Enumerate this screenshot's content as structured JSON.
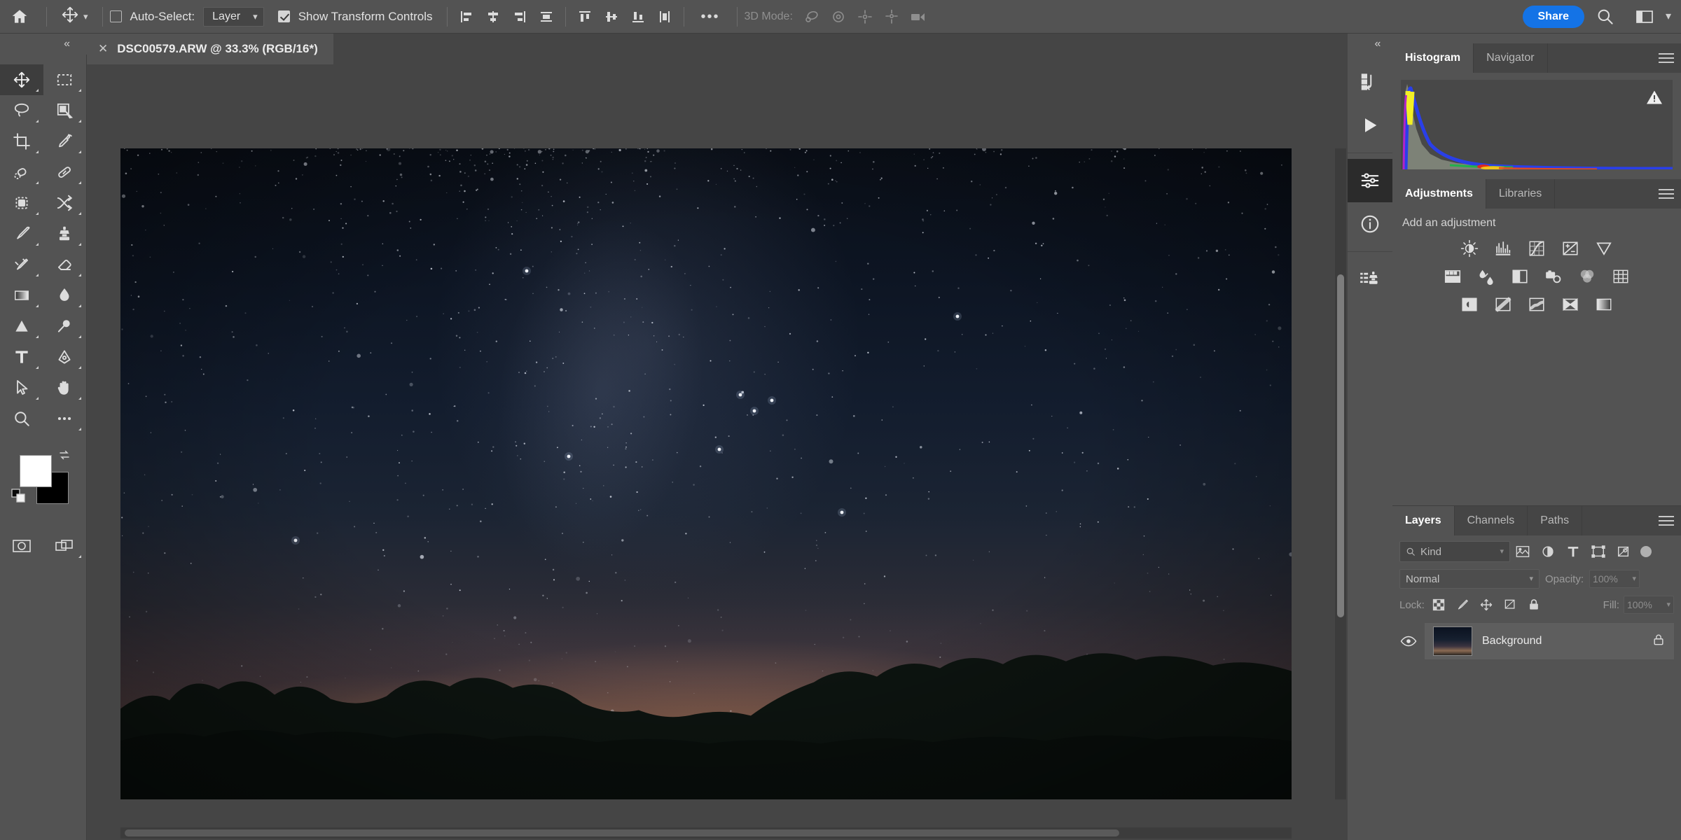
{
  "options_bar": {
    "home_icon": "home-icon",
    "tool_icon": "move-tool-icon",
    "auto_select_checked": false,
    "auto_select_label": "Auto-Select:",
    "auto_select_value": "Layer",
    "show_transform_checked": true,
    "show_transform_label": "Show Transform Controls",
    "align_icons": [
      "align-left-edges-icon",
      "align-horizontal-centers-icon",
      "align-right-edges-icon",
      "distribute-horizontally-icon",
      "align-top-edges-icon",
      "align-vertical-centers-icon",
      "align-bottom-edges-icon",
      "distribute-vertically-icon"
    ],
    "more_icon": "more-options-icon",
    "mode_3d_label": "3D Mode:",
    "mode_3d_icons": [
      "orbit-3d-icon",
      "roll-3d-icon",
      "pan-3d-icon",
      "slide-3d-icon",
      "scale-3d-camera-icon"
    ],
    "share_label": "Share",
    "search_icon": "search-icon",
    "workspace_icon": "workspace-switcher-icon",
    "workspace_chevron": "chevron-down-icon"
  },
  "tab_bar": {
    "close_icon": "close-icon",
    "document_title": "DSC00579.ARW @ 33.3% (RGB/16*)",
    "collapse_left": "«",
    "collapse_right": "«"
  },
  "toolbar": {
    "tools": [
      {
        "name": "move-tool",
        "selected": true
      },
      {
        "name": "rectangular-marquee-tool",
        "selected": false
      },
      {
        "name": "lasso-tool",
        "selected": false
      },
      {
        "name": "object-selection-tool",
        "selected": false
      },
      {
        "name": "crop-tool",
        "selected": false
      },
      {
        "name": "eyedropper-tool",
        "selected": false
      },
      {
        "name": "spot-healing-brush-tool",
        "selected": false
      },
      {
        "name": "patch-tool",
        "selected": false
      },
      {
        "name": "remove-tool",
        "selected": false
      },
      {
        "name": "content-aware-move-tool",
        "selected": false
      },
      {
        "name": "brush-tool",
        "selected": false
      },
      {
        "name": "clone-stamp-tool",
        "selected": false
      },
      {
        "name": "history-brush-tool",
        "selected": false
      },
      {
        "name": "eraser-tool",
        "selected": false
      },
      {
        "name": "gradient-tool",
        "selected": false
      },
      {
        "name": "blur-tool",
        "selected": false
      },
      {
        "name": "dodge-tool",
        "selected": false
      },
      {
        "name": "pen-tool",
        "selected": false
      },
      {
        "name": "type-tool",
        "selected": false
      },
      {
        "name": "shape-tool",
        "selected": false
      },
      {
        "name": "path-selection-tool",
        "selected": false
      },
      {
        "name": "hand-tool",
        "selected": false
      },
      {
        "name": "zoom-tool",
        "selected": false
      },
      {
        "name": "edit-toolbar-tool",
        "selected": false
      }
    ],
    "foreground_color": "#ffffff",
    "background_color": "#000000",
    "swap_icon": "swap-colors-icon",
    "default_icon": "default-colors-icon",
    "quick_mask_icon": "quick-mask-icon",
    "screen_mode_icon": "screen-mode-icon"
  },
  "canvas": {
    "zoom_level": "33.3%",
    "image_alt": "night-sky-milky-way-over-treeline",
    "scrollbar_vertical": "vertical-scrollbar",
    "scrollbar_horizontal": "horizontal-scrollbar"
  },
  "icon_rail": {
    "items": [
      {
        "name": "history-icon",
        "active": false
      },
      {
        "name": "actions-play-icon",
        "active": false
      },
      {
        "name": "properties-sliders-icon",
        "active": true
      },
      {
        "name": "info-icon",
        "active": false
      },
      {
        "name": "clone-source-icon",
        "active": false
      }
    ]
  },
  "histogram_panel": {
    "tabs": [
      {
        "label": "Histogram",
        "active": true
      },
      {
        "label": "Navigator",
        "active": false
      }
    ],
    "menu_icon": "panel-menu-icon",
    "warning_icon": "cached-data-warning-icon"
  },
  "adjustments_panel": {
    "tabs": [
      {
        "label": "Adjustments",
        "active": true
      },
      {
        "label": "Libraries",
        "active": false
      }
    ],
    "menu_icon": "panel-menu-icon",
    "heading": "Add an adjustment",
    "rows": [
      [
        "brightness-contrast-icon",
        "levels-icon",
        "curves-icon",
        "exposure-icon",
        "vibrance-icon"
      ],
      [
        "hue-saturation-icon",
        "color-balance-icon",
        "black-white-icon",
        "photo-filter-icon",
        "channel-mixer-icon",
        "color-lookup-icon"
      ],
      [
        "invert-icon",
        "posterize-icon",
        "threshold-icon",
        "selective-color-icon",
        "gradient-map-icon"
      ]
    ]
  },
  "layers_panel": {
    "tabs": [
      {
        "label": "Layers",
        "active": true
      },
      {
        "label": "Channels",
        "active": false
      },
      {
        "label": "Paths",
        "active": false
      }
    ],
    "menu_icon": "panel-menu-icon",
    "filter_label": "Kind",
    "filter_icons": [
      "filter-pixel-icon",
      "filter-adjustment-icon",
      "filter-type-icon",
      "filter-shape-icon",
      "filter-smart-object-icon"
    ],
    "filter_toggle": "filter-enable-toggle",
    "blend_mode": "Normal",
    "opacity_label": "Opacity:",
    "opacity_value": "100%",
    "lock_label": "Lock:",
    "lock_icons": [
      "lock-transparent-pixels-icon",
      "lock-image-pixels-icon",
      "lock-position-icon",
      "lock-artboard-nesting-icon",
      "lock-all-icon"
    ],
    "fill_label": "Fill:",
    "fill_value": "100%",
    "layers": [
      {
        "name": "Background",
        "visible": true,
        "locked": true,
        "visibility_icon": "eye-icon",
        "lock_icon": "lock-icon"
      }
    ]
  },
  "colors": {
    "accent_blue": "#1473e6",
    "panel_bg": "#535353",
    "canvas_bg": "#454545",
    "selected_tool_bg": "#3d3d3d",
    "layer_selected_bg": "#5e5e5e"
  }
}
